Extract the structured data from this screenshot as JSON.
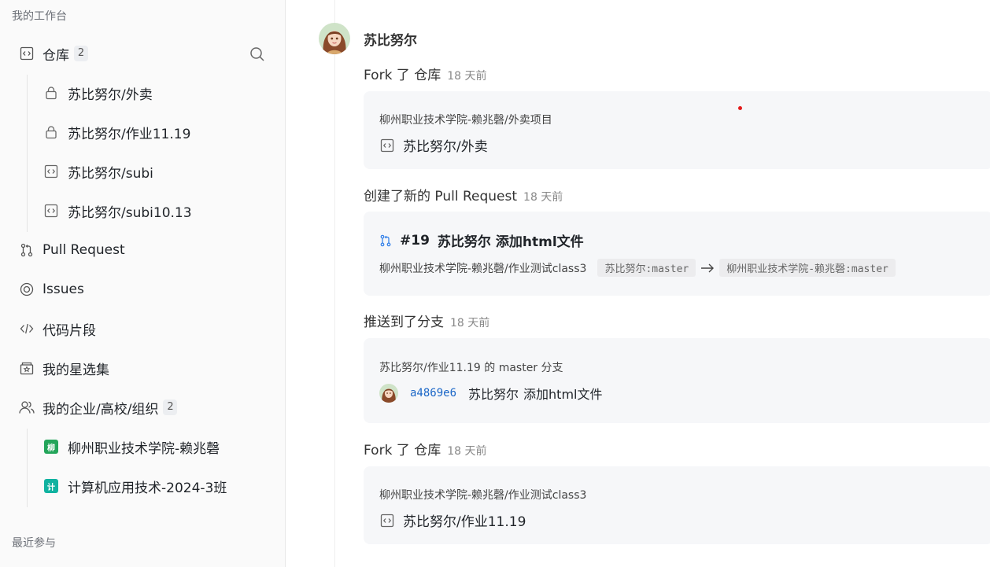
{
  "sidebar": {
    "workspace_heading": "我的工作台",
    "repos": {
      "label": "仓库",
      "count": "2"
    },
    "repo_items": [
      {
        "label": "苏比努尔/外卖",
        "icon": "lock-icon"
      },
      {
        "label": "苏比努尔/作业11.19",
        "icon": "lock-icon"
      },
      {
        "label": "苏比努尔/subi",
        "icon": "repo-icon"
      },
      {
        "label": "苏比努尔/subi10.13",
        "icon": "repo-icon"
      }
    ],
    "pull_request": "Pull Request",
    "issues": "Issues",
    "snippets": "代码片段",
    "stars": "我的星选集",
    "orgs": {
      "label": "我的企业/高校/组织",
      "count": "2"
    },
    "org_items": [
      {
        "label": "柳州职业技术学院-赖兆磬",
        "badge": "柳",
        "color": "#23a55a"
      },
      {
        "label": "计算机应用技术-2024-3班",
        "badge": "计",
        "color": "#10b2a0"
      }
    ],
    "recent_heading": "最近参与"
  },
  "feed": {
    "user_name": "苏比努尔",
    "events": [
      {
        "action": "Fork 了 仓库",
        "time": "18 天前",
        "source": "柳州职业技术学院-赖兆磬/外卖项目",
        "repo": "苏比努尔/外卖"
      },
      {
        "action": "创建了新的 Pull Request",
        "time": "18 天前",
        "pr_number": "#19",
        "pr_author": "苏比努尔",
        "pr_title": "添加html文件",
        "pr_repo": "柳州职业技术学院-赖兆磬/作业测试class3",
        "head_branch": "苏比努尔:master",
        "base_branch": "柳州职业技术学院-赖兆磬:master"
      },
      {
        "action": "推送到了分支",
        "time": "18 天前",
        "branch_line": "苏比努尔/作业11.19 的 master 分支",
        "sha": "a4869e6",
        "commit_author": "苏比努尔",
        "commit_msg": "添加html文件"
      },
      {
        "action": "Fork 了 仓库",
        "time": "18 天前",
        "source": "柳州职业技术学院-赖兆磬/作业测试class3",
        "repo": "苏比努尔/作业11.19"
      }
    ]
  },
  "colors": {
    "accent_link": "#1a66c7",
    "org_green": "#23a55a",
    "org_teal": "#10b2a0",
    "cursor_dot": "#e31b1b"
  }
}
